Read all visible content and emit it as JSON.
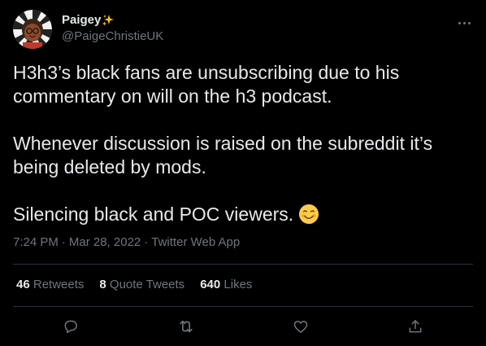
{
  "user": {
    "display_name": "Paigey",
    "name_emoji": "sparkles-icon",
    "handle": "@PaigeChristieUK"
  },
  "tweet": {
    "paragraphs": [
      "H3h3’s black fans are unsubscribing due to his commentary on will on the h3 podcast.",
      "Whenever discussion is raised on the subreddit it’s being deleted by mods.",
      "Silencing black and POC viewers."
    ],
    "trailing_emoji": "smiling-face-icon"
  },
  "meta": {
    "time": "7:24 PM",
    "date": "Mar 28, 2022",
    "source": "Twitter Web App",
    "separator": "·"
  },
  "stats": {
    "retweets_count": "46",
    "retweets_label": "Retweets",
    "quotes_count": "8",
    "quotes_label": "Quote Tweets",
    "likes_count": "640",
    "likes_label": "Likes"
  },
  "actions": [
    "reply-icon",
    "retweet-icon",
    "like-icon",
    "share-icon"
  ],
  "colors": {
    "background": "#000000",
    "text_primary": "#e7e9ea",
    "text_secondary": "#71767b",
    "divider": "#2f3336"
  }
}
